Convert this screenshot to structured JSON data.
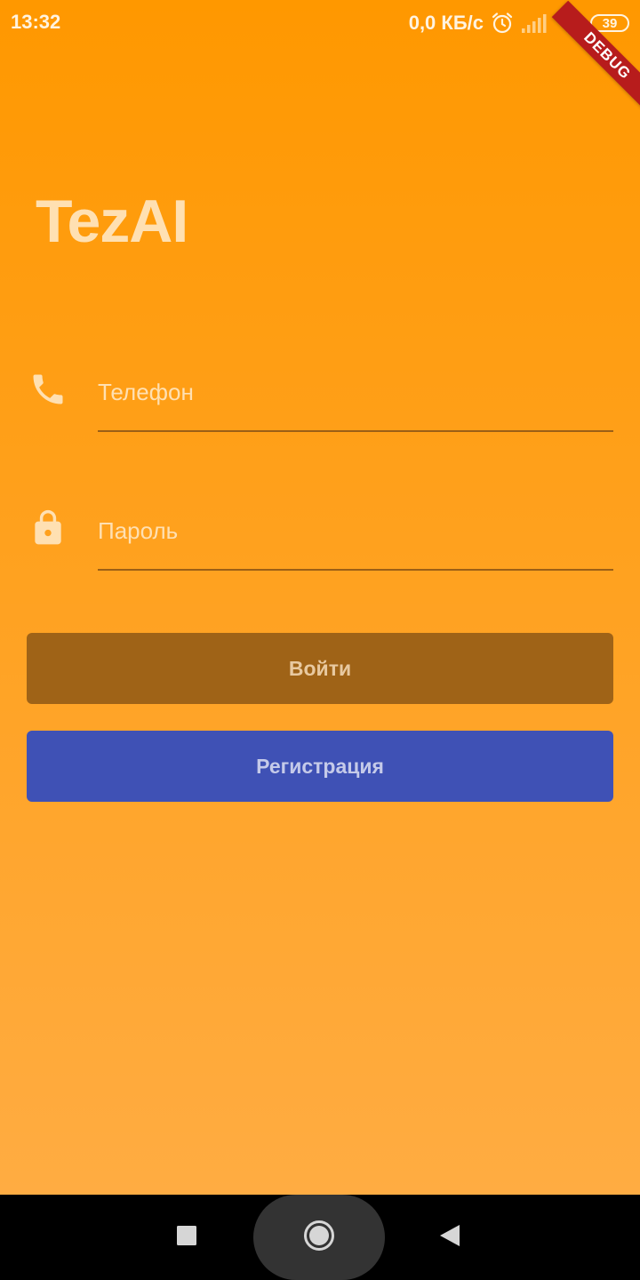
{
  "status_bar": {
    "time": "13:32",
    "net_speed": "0,0 КБ/с",
    "battery": "39",
    "icons": [
      "alarm-icon",
      "signal-icon",
      "wifi-icon",
      "battery-icon"
    ]
  },
  "debug_banner": {
    "label": "DEBUG"
  },
  "app": {
    "title": "TezAI"
  },
  "form": {
    "phone": {
      "placeholder": "Телефон",
      "value": "",
      "icon": "phone-icon"
    },
    "password": {
      "placeholder": "Пароль",
      "value": "",
      "icon": "lock-icon"
    }
  },
  "buttons": {
    "login_label": "Войти",
    "register_label": "Регистрация"
  },
  "colors": {
    "background_top": "#ff9800",
    "background_bottom": "#ffac42",
    "login_button": "#9f6317",
    "register_button": "#3f51b5",
    "debug_banner": "#b71c1c"
  },
  "nav_bar": {
    "icons": [
      "recents-icon",
      "home-icon",
      "back-icon"
    ]
  }
}
